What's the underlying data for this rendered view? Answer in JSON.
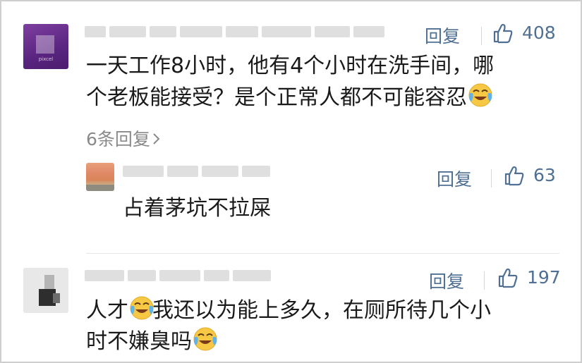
{
  "comments": [
    {
      "reply_label": "回复",
      "likes": "408",
      "text_line1": "一天工作8小时，他有4个小时在洗手间，哪",
      "text_line2": "个老板能接受？是个正常人都不可能容忍",
      "more_replies": "6条回复",
      "avatar_brand": "pixcel",
      "emoji_icon": "crying-laughing-emoji"
    },
    {
      "reply_label": "回复",
      "likes": "63",
      "text": "占着茅坑不拉屎"
    },
    {
      "reply_label": "回复",
      "likes": "197",
      "text_part1": "人才",
      "text_part2": "我还以为能上多久，在厕所待几个小",
      "text_line2": "时不嫌臭吗",
      "emoji_icon": "crying-laughing-emoji"
    }
  ],
  "colors": {
    "action_blue": "#4f6f93",
    "muted_gray": "#8a8a8a",
    "text": "#1a1a1a",
    "avatar_purple": "#5a2580"
  }
}
